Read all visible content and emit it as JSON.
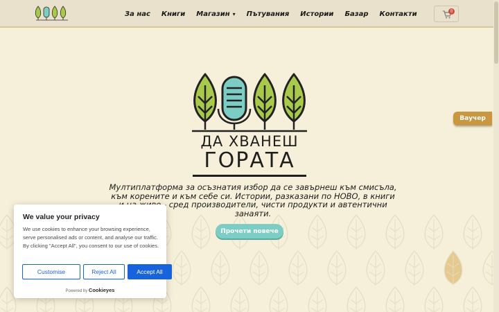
{
  "header": {
    "nav": [
      {
        "label": "За нас",
        "name": "nav-about",
        "has_dropdown": false
      },
      {
        "label": "Книги",
        "name": "nav-books",
        "has_dropdown": false
      },
      {
        "label": "Магазин",
        "name": "nav-shop",
        "has_dropdown": true
      },
      {
        "label": "Пътувания",
        "name": "nav-travels",
        "has_dropdown": false
      },
      {
        "label": "Истории",
        "name": "nav-stories",
        "has_dropdown": false
      },
      {
        "label": "Базар",
        "name": "nav-bazaar",
        "has_dropdown": false
      },
      {
        "label": "Контакти",
        "name": "nav-contacts",
        "has_dropdown": false
      }
    ],
    "cart_count": "0",
    "cart_icon": "shopping-cart-icon"
  },
  "hero": {
    "brand_line1": "ДА ХВАНЕШ",
    "brand_line2": "ГОРАТА",
    "tagline": "Мултиплатформа за осъзнатия избор да се завърнеш към смисъла, към корените и към себе си. Истории, разказани по НОВО, в книги и на живо - сред производители, чисти продукти и автентични занаяти.",
    "read_more_label": "Прочети повече"
  },
  "voucher_label": "Ваучер",
  "cookie": {
    "title": "We value your privacy",
    "text": "We use cookies to enhance your browsing experience, serve personalised ads or content, and analyse our traffic. By clicking \"Accept All\", you consent to our use of cookies.",
    "customise_label": "Customise",
    "reject_label": "Reject All",
    "accept_label": "Accept All",
    "powered_prefix": "Powered by",
    "powered_brand": "Cookieyes"
  },
  "colors": {
    "background": "#f6efd9",
    "header": "#e9e1cb",
    "leaf_green": "#a9c94a",
    "mic_teal": "#7ccdc4",
    "button_teal": "#7ccdc4",
    "voucher_gold": "#c9973f",
    "cookie_blue": "#1863dc"
  }
}
